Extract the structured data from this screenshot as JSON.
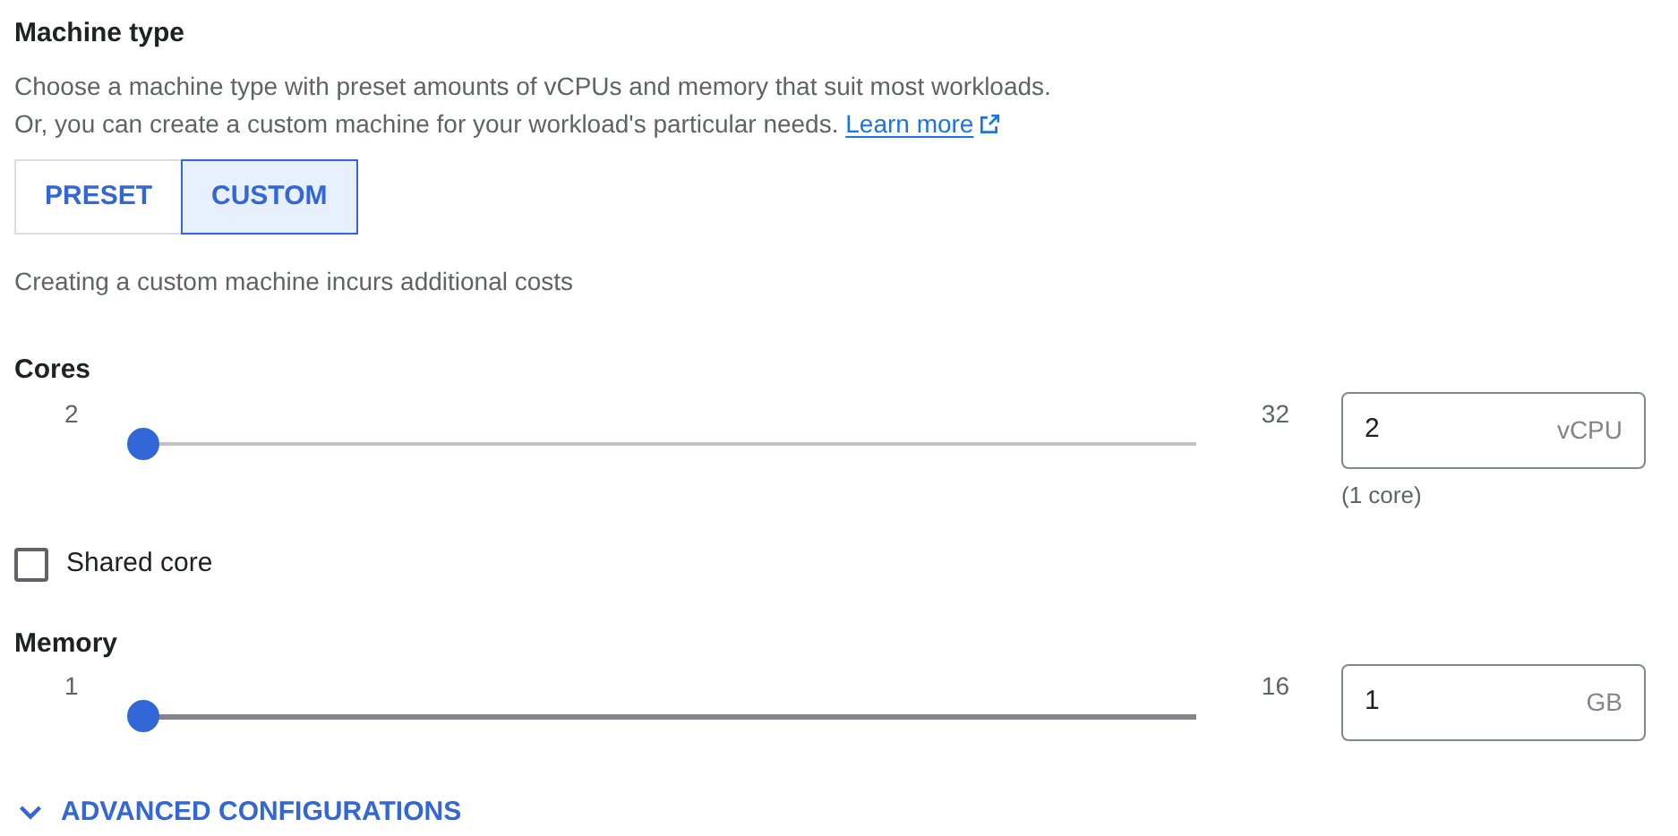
{
  "title": "Machine type",
  "description_lines": [
    "Choose a machine type with preset amounts of vCPUs and memory that suit most workloads.",
    "Or, you can create a custom machine for your workload's particular needs."
  ],
  "learn_more_link": "Learn more",
  "mode_tabs": [
    {
      "label": "PRESET",
      "selected": false
    },
    {
      "label": "CUSTOM",
      "selected": true
    }
  ],
  "cost_note": "Creating a custom machine incurs additional costs",
  "cores": {
    "label": "Cores",
    "min": "2",
    "max": "32",
    "level": 0,
    "value": "2",
    "unit": "vCPU",
    "helper": "(1 core)"
  },
  "shared_core": {
    "label": "Shared core",
    "checked": false
  },
  "memory": {
    "label": "Memory",
    "min": "1",
    "max": "16",
    "level": 0,
    "value": "1",
    "unit": "GB"
  },
  "advanced": {
    "label": "ADVANCED CONFIGURATIONS",
    "expanded": false
  }
}
